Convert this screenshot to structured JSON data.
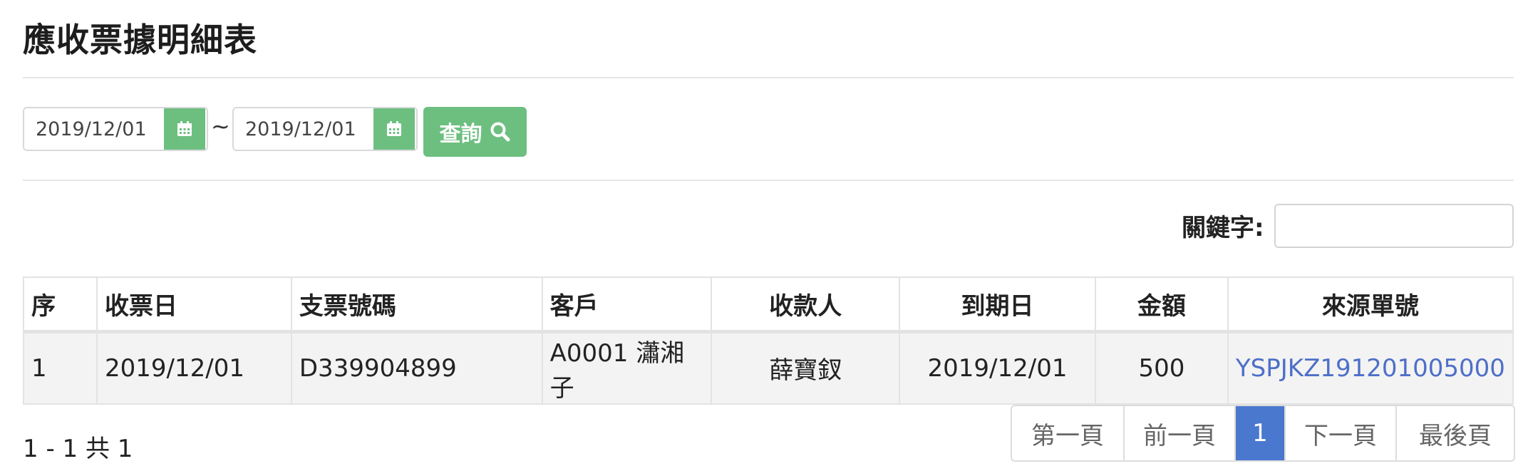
{
  "page": {
    "title": "應收票據明細表"
  },
  "filters": {
    "start_date": "2019/12/01",
    "separator": "~",
    "end_date": "2019/12/01",
    "query_label": "查詢",
    "calendar_icon": "calendar-icon",
    "search_icon": "search-icon"
  },
  "keyword": {
    "label": "關鍵字:",
    "value": ""
  },
  "table": {
    "headers": {
      "seq": "序",
      "receive_date": "收票日",
      "check_no": "支票號碼",
      "customer": "客戶",
      "payee": "收款人",
      "due_date": "到期日",
      "amount": "金額",
      "source_no": "來源單號"
    },
    "rows": [
      {
        "seq": "1",
        "receive_date": "2019/12/01",
        "check_no": "D339904899",
        "customer": "A0001 瀟湘子",
        "payee": "薛寶釵",
        "due_date": "2019/12/01",
        "amount": "500",
        "source_no": "YSPJKZ191201005000"
      }
    ]
  },
  "pagination": {
    "summary": "1 - 1 共 1",
    "first": "第一頁",
    "prev": "前一頁",
    "current": "1",
    "next": "下一頁",
    "last": "最後頁"
  },
  "colors": {
    "accent_green": "#6dbf80",
    "active_page_blue": "#4a78cf",
    "link_blue": "#4d6fc8"
  }
}
